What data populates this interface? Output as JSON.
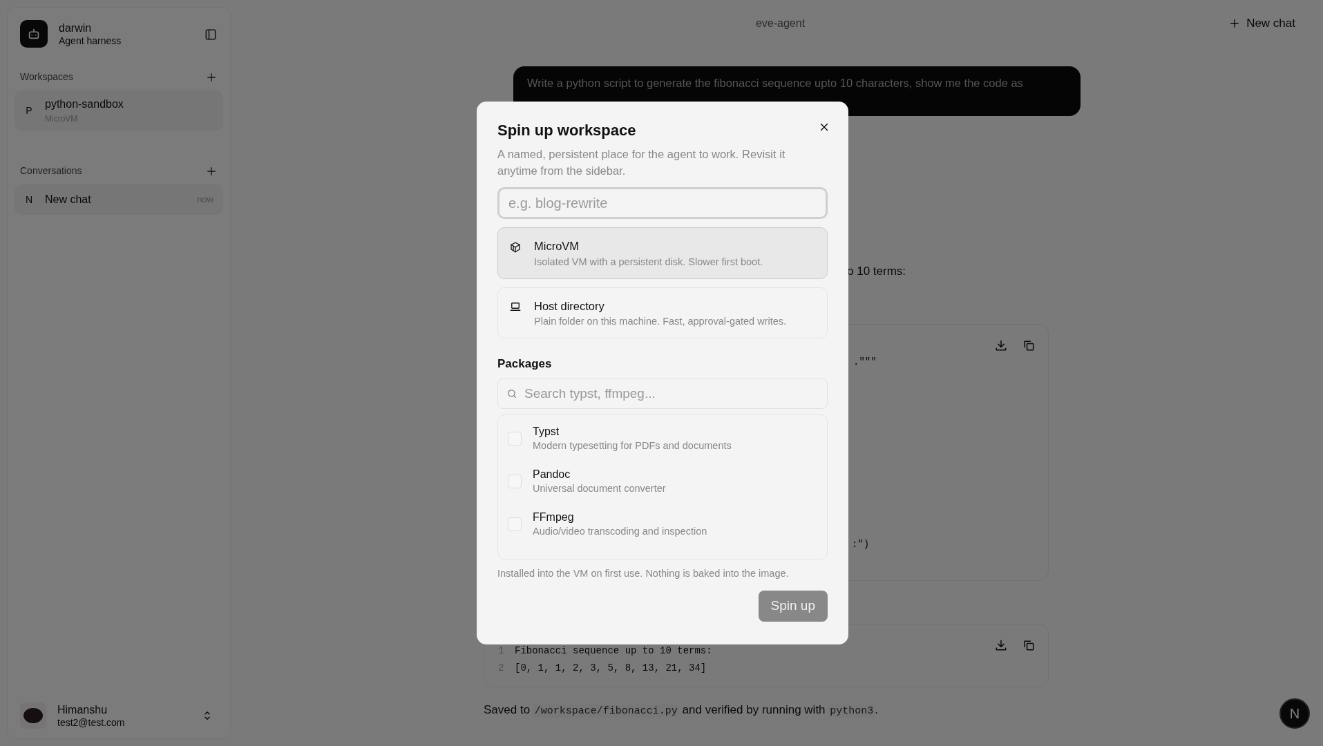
{
  "sidebar": {
    "brand": {
      "name": "darwin",
      "subtitle": "Agent harness"
    },
    "sections": [
      {
        "title": "Workspaces",
        "items": [
          {
            "initial": "P",
            "name": "python-sandbox",
            "subtitle": "MicroVM"
          }
        ]
      },
      {
        "title": "Conversations",
        "items": [
          {
            "initial": "N",
            "name": "New chat",
            "time": "now"
          }
        ]
      }
    ],
    "user": {
      "name": "Himanshu",
      "email": "test2@test.com"
    }
  },
  "header": {
    "title": "eve-agent",
    "new_chat": "New chat"
  },
  "chat": {
    "user_message": "Write a python script to generate the fibonacci sequence upto 10 characters, show me the code as",
    "blocks": [
      {
        "kind": "text",
        "text": "o 10 terms:"
      },
      {
        "kind": "code",
        "lines": [
          {
            "text": ".\"\"\""
          },
          {
            "text": ":\")"
          }
        ]
      },
      {
        "kind": "output",
        "lines": [
          {
            "number": "1",
            "text": "Fibonacci sequence up to 10 terms:"
          },
          {
            "number": "2",
            "text": "[0, 1, 1, 2, 3, 5, 8, 13, 21, 34]"
          }
        ]
      },
      {
        "kind": "rich",
        "parts": [
          {
            "kind": "text",
            "text": "Saved to "
          },
          {
            "kind": "code",
            "text": "/workspace/fibonacci.py"
          },
          {
            "kind": "text",
            "text": " and verified by running with "
          },
          {
            "kind": "code",
            "text": "python3"
          },
          {
            "kind": "text",
            "text": "."
          }
        ]
      }
    ]
  },
  "dev_badge": "N",
  "modal": {
    "title": "Spin up workspace",
    "description": "A named, persistent place for the agent to work. Revisit it anytime from the sidebar.",
    "name_field": {
      "placeholder": "e.g. blog-rewrite"
    },
    "types": [
      {
        "kind": "vm",
        "name": "MicroVM",
        "description": "Isolated VM with a persistent disk. Slower first boot.",
        "selected": true
      },
      {
        "kind": "host",
        "name": "Host directory",
        "description": "Plain folder on this machine. Fast, approval-gated writes.",
        "selected": false
      }
    ],
    "packages": {
      "label": "Packages",
      "search_placeholder": "Search typst, ffmpeg...",
      "items": [
        {
          "name": "Typst",
          "description": "Modern typesetting for PDFs and documents",
          "checked": false
        },
        {
          "name": "Pandoc",
          "description": "Universal document converter",
          "checked": false
        },
        {
          "name": "FFmpeg",
          "description": "Audio/video transcoding and inspection",
          "checked": false
        }
      ]
    },
    "note": "Installed into the VM on first use. Nothing is baked into the image.",
    "submit": {
      "label": "Spin up",
      "disabled": true
    }
  }
}
